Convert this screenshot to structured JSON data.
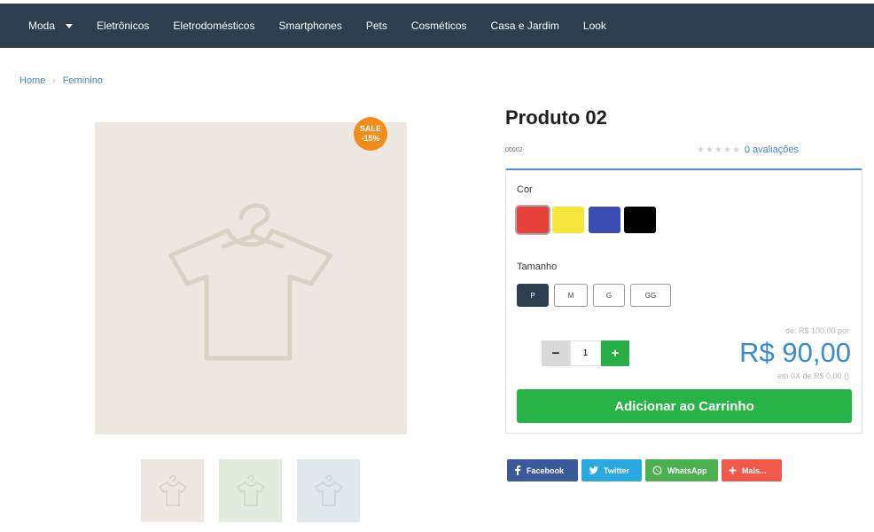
{
  "nav": {
    "items": [
      {
        "label": "Moda",
        "has_dropdown": true
      },
      {
        "label": "Eletrônicos"
      },
      {
        "label": "Eletrodomésticos"
      },
      {
        "label": "Smartphones"
      },
      {
        "label": "Pets"
      },
      {
        "label": "Cosméticos"
      },
      {
        "label": "Casa e Jardim"
      },
      {
        "label": "Look"
      }
    ],
    "background": "#2c3e50"
  },
  "breadcrumb": {
    "home": "Home",
    "current": "Feminino",
    "separator": "›"
  },
  "product": {
    "title": "Produto 02",
    "sku": "00002",
    "rating": {
      "stars": "★★★★★",
      "label": "0 avaliações"
    },
    "sale_badge": {
      "line1": "SALE",
      "line2": "-15%",
      "color": "#f28c1b"
    },
    "image_icon": "t-shirt-hanger-icon",
    "thumbnails_count": 3
  },
  "options": {
    "color_label": "Cor",
    "colors": [
      {
        "name": "red",
        "hex": "#e8413a",
        "selected": true
      },
      {
        "name": "yellow",
        "hex": "#f7e73a"
      },
      {
        "name": "blue",
        "hex": "#3b4db5"
      },
      {
        "name": "black",
        "hex": "#000000"
      }
    ],
    "size_label": "Tamanho",
    "sizes": [
      {
        "label": "P",
        "active": true
      },
      {
        "label": "M"
      },
      {
        "label": "G"
      },
      {
        "label": "GG"
      }
    ]
  },
  "purchase": {
    "quantity": "1",
    "minus": "−",
    "plus": "+",
    "old_price": "de: R$ 100,00 por",
    "price": "R$ 90,00",
    "installments": "em 0X de R$ 0,00 ()",
    "add_to_cart": "Adicionar ao Carrinho",
    "accent_green": "#26b446",
    "price_color": "#3a8ad1"
  },
  "share": [
    {
      "label": "Facebook",
      "icon": "facebook-icon",
      "color": "#3b5a9a"
    },
    {
      "label": "Twitter",
      "icon": "twitter-icon",
      "color": "#2aa9e0"
    },
    {
      "label": "WhatsApp",
      "icon": "whatsapp-icon",
      "color": "#4caf50"
    },
    {
      "label": "Mais...",
      "icon": "plus-icon",
      "color": "#f15a4a"
    }
  ]
}
